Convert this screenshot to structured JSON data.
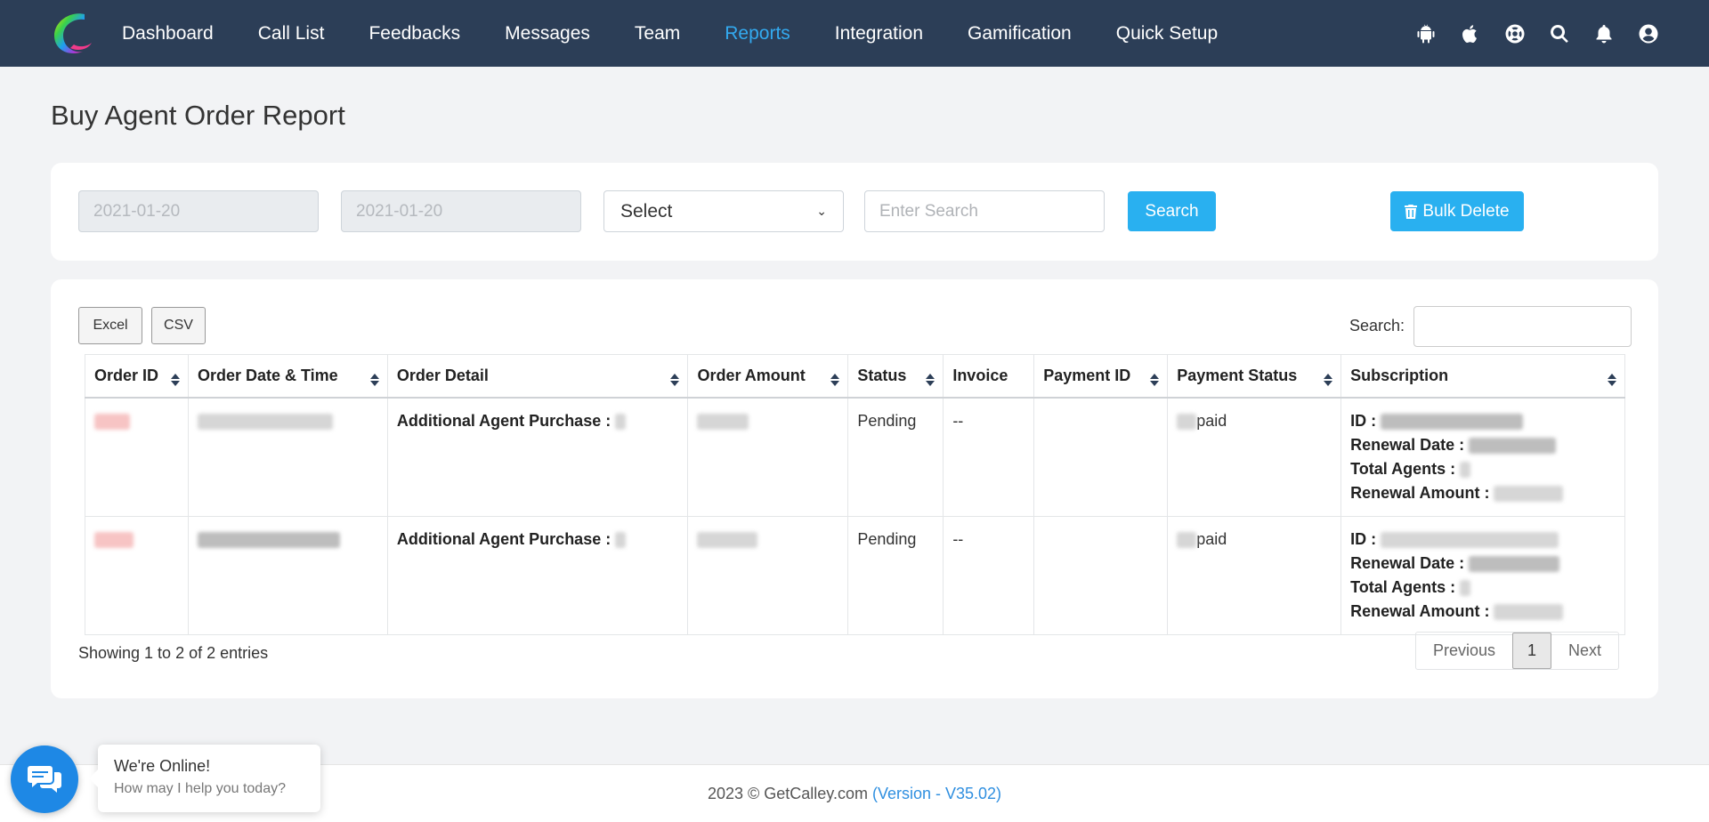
{
  "nav": {
    "items": [
      "Dashboard",
      "Call List",
      "Feedbacks",
      "Messages",
      "Team",
      "Reports",
      "Integration",
      "Gamification",
      "Quick Setup"
    ],
    "active": "Reports",
    "icons": [
      "android-icon",
      "apple-icon",
      "support-icon",
      "search-icon",
      "bell-icon",
      "user-icon"
    ]
  },
  "page": {
    "title": "Buy Agent Order Report"
  },
  "filters": {
    "from_date": "2021-01-20",
    "to_date": "2021-01-20",
    "select_value": "Select",
    "search_placeholder": "Enter Search",
    "search_button": "Search",
    "bulk_delete_button": "Bulk Delete"
  },
  "table_tools": {
    "excel": "Excel",
    "csv": "CSV",
    "search_label": "Search:"
  },
  "table": {
    "headers": [
      "Order ID",
      "Order Date & Time",
      "Order Detail",
      "Order Amount",
      "Status",
      "Invoice",
      "Payment ID",
      "Payment Status",
      "Subscription"
    ],
    "rows": [
      {
        "order_detail_label": "Additional Agent Purchase :",
        "status": "Pending",
        "invoice": "--",
        "payment_status": "paid",
        "sub_id_label": "ID :",
        "sub_renewal_date_label": "Renewal Date :",
        "sub_total_agents_label": "Total Agents :",
        "sub_renewal_amount_label": "Renewal Amount :"
      },
      {
        "order_detail_label": "Additional Agent Purchase :",
        "status": "Pending",
        "invoice": "--",
        "payment_status": "paid",
        "sub_id_label": "ID :",
        "sub_renewal_date_label": "Renewal Date :",
        "sub_total_agents_label": "Total Agents :",
        "sub_renewal_amount_label": "Renewal Amount :"
      }
    ]
  },
  "pagination": {
    "info": "Showing 1 to 2 of 2 entries",
    "previous": "Previous",
    "current": "1",
    "next": "Next"
  },
  "footer": {
    "copyright": "2023 © GetCalley.com",
    "version": "(Version - V35.02)"
  },
  "chat": {
    "title": "We're Online!",
    "subtitle": "How may I help you today?"
  },
  "colors": {
    "navbar": "#2c3e57",
    "active_nav": "#33aaf0",
    "primary_button": "#29b0f0",
    "chat_button": "#1e88e5"
  }
}
